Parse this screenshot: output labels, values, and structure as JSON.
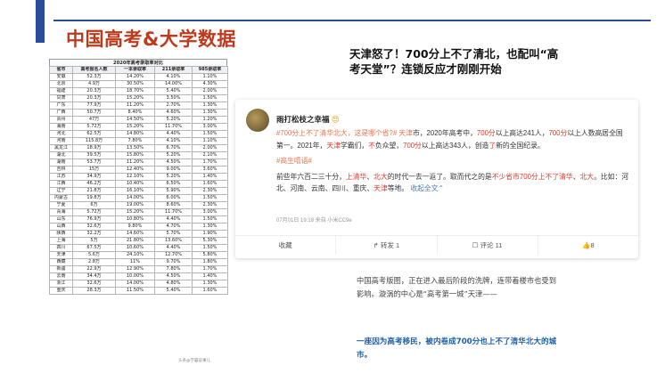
{
  "title": "中国高考&大学数据",
  "table": {
    "caption": "2020年高考录取率对比",
    "headers": [
      "省市",
      "高考报名人数",
      "一本录取率",
      "211录取率",
      "985录取率"
    ],
    "rows": [
      [
        "安徽",
        "52.3万",
        "14.20%",
        "4.10%",
        "1.10%"
      ],
      [
        "北京",
        "4.9万",
        "30.50%",
        "14.00%",
        "4.30%"
      ],
      [
        "福建",
        "20.3万",
        "18.70%",
        "5.40%",
        "2.00%"
      ],
      [
        "甘肃",
        "20.3万",
        "15.20%",
        "3.50%",
        "1.50%"
      ],
      [
        "广东",
        "77.9万",
        "11.20%",
        "2.70%",
        "1.30%"
      ],
      [
        "广西",
        "50.7万",
        "8.40%",
        "4.60%",
        "1.30%"
      ],
      [
        "贵州",
        "47万",
        "14.50%",
        "5.20%",
        "1.20%"
      ],
      [
        "海南",
        "5.72万",
        "15.20%",
        "11.70%",
        "3.00%"
      ],
      [
        "河北",
        "62.5万",
        "14.80%",
        "4.40%",
        "1.50%"
      ],
      [
        "河南",
        "115.8万",
        "7.80%",
        "4.10%",
        "1.10%"
      ],
      [
        "黑龙江",
        "18.9万",
        "13.50%",
        "6.70%",
        "2.00%"
      ],
      [
        "湖北",
        "39.5万",
        "15.80%",
        "5.20%",
        "2.10%"
      ],
      [
        "湖南",
        "53.7万",
        "11.20%",
        "4.50%",
        "1.70%"
      ],
      [
        "吉林",
        "15万",
        "12.40%",
        "9.00%",
        "3.60%"
      ],
      [
        "江苏",
        "34.9万",
        "12.10%",
        "5.20%",
        "1.40%"
      ],
      [
        "江西",
        "46.2万",
        "10.40%",
        "6.50%",
        "1.60%"
      ],
      [
        "辽宁",
        "21.8万",
        "16.10%",
        "5.90%",
        "2.30%"
      ],
      [
        "内蒙古",
        "19.8万",
        "14.00%",
        "6.00%",
        "1.50%"
      ],
      [
        "宁夏",
        "6万",
        "19.00%",
        "8.60%",
        "2.30%"
      ],
      [
        "青海",
        "5.72万",
        "15.20%",
        "11.70%",
        "3.00%"
      ],
      [
        "山东",
        "76.9万",
        "10.80%",
        "4.40%",
        "1.50%"
      ],
      [
        "山西",
        "32.6万",
        "9.80%",
        "4.70%",
        "1.30%"
      ],
      [
        "陕西",
        "32.2万",
        "14.60%",
        "5.70%",
        "1.90%"
      ],
      [
        "上海",
        "5万",
        "21.80%",
        "13.60%",
        "5.30%"
      ],
      [
        "四川",
        "67.5万",
        "10.60%",
        "4.40%",
        "1.50%"
      ],
      [
        "天津",
        "5.6万",
        "24.10%",
        "12.70%",
        "5.80%"
      ],
      [
        "西藏",
        "2.8万",
        "11%",
        "9.70%",
        "1.80%"
      ],
      [
        "新疆",
        "22.9万",
        "12.90%",
        "7.80%",
        "1.70%"
      ],
      [
        "云南",
        "34.4万",
        "10.00%",
        "4.50%",
        "1.40%"
      ],
      [
        "浙江",
        "32.6万",
        "14.00%",
        "4.80%",
        "1.30%"
      ],
      [
        "重庆",
        "28.3万",
        "11.50%",
        "5.40%",
        "1.60%"
      ]
    ]
  },
  "headline": "天津怒了！700分上不了清北，也配叫“高考天堂”？连锁反应才刚刚开始",
  "card": {
    "username": "雨打松枝之幸福",
    "emoji": "😍",
    "p1": {
      "tag1": "#700分上不了清华北大，这是哪个省?",
      "tag2": "#",
      "city": " 天津",
      "t1": "市，2020年高考中，",
      "hl1": "700分",
      "t2": "以上高达241人，",
      "hl2": "700分",
      "t3": "以上人数高居全国第一。2021年，",
      "hl3": "天津",
      "t4": "学霸们，",
      "hl4": "不",
      "t5": "负众望，",
      "hl5": "700分",
      "t6": "以上高达343人，创造",
      "hl6": "了",
      "t7": "新的全国纪录。"
    },
    "tag3": "#高生嘻语#",
    "p2": {
      "t1": "前些年六百二三十分，",
      "hl1": "上清华",
      "t2": "、",
      "hl2": "北大",
      "t3": "的时代一去一返了。取而代之的是",
      "hl3": "不少省市700分上不了清华",
      "t4": "、",
      "hl4": "北大",
      "t5": "。比如：河北、河南、云南、四川、重庆、",
      "hl5": "天津",
      "t6": "等地。",
      "more": "收起全文",
      "more_icon": "chevron-up"
    },
    "meta": "07月01日 19:18  来自 小米CC9e",
    "actions": [
      "收藏",
      "转发 1",
      "评论 11",
      "8"
    ]
  },
  "body_text": "中国高考版图，正在进入最后阶段的洗牌，连带着楼市也受到影响。漩涡的中心是“高考第一城”天津——",
  "conclusion": "一座因为高考移民，被内卷成700分也上不了清华北大的城市。",
  "watermark": "头条@学霸说事儿"
}
